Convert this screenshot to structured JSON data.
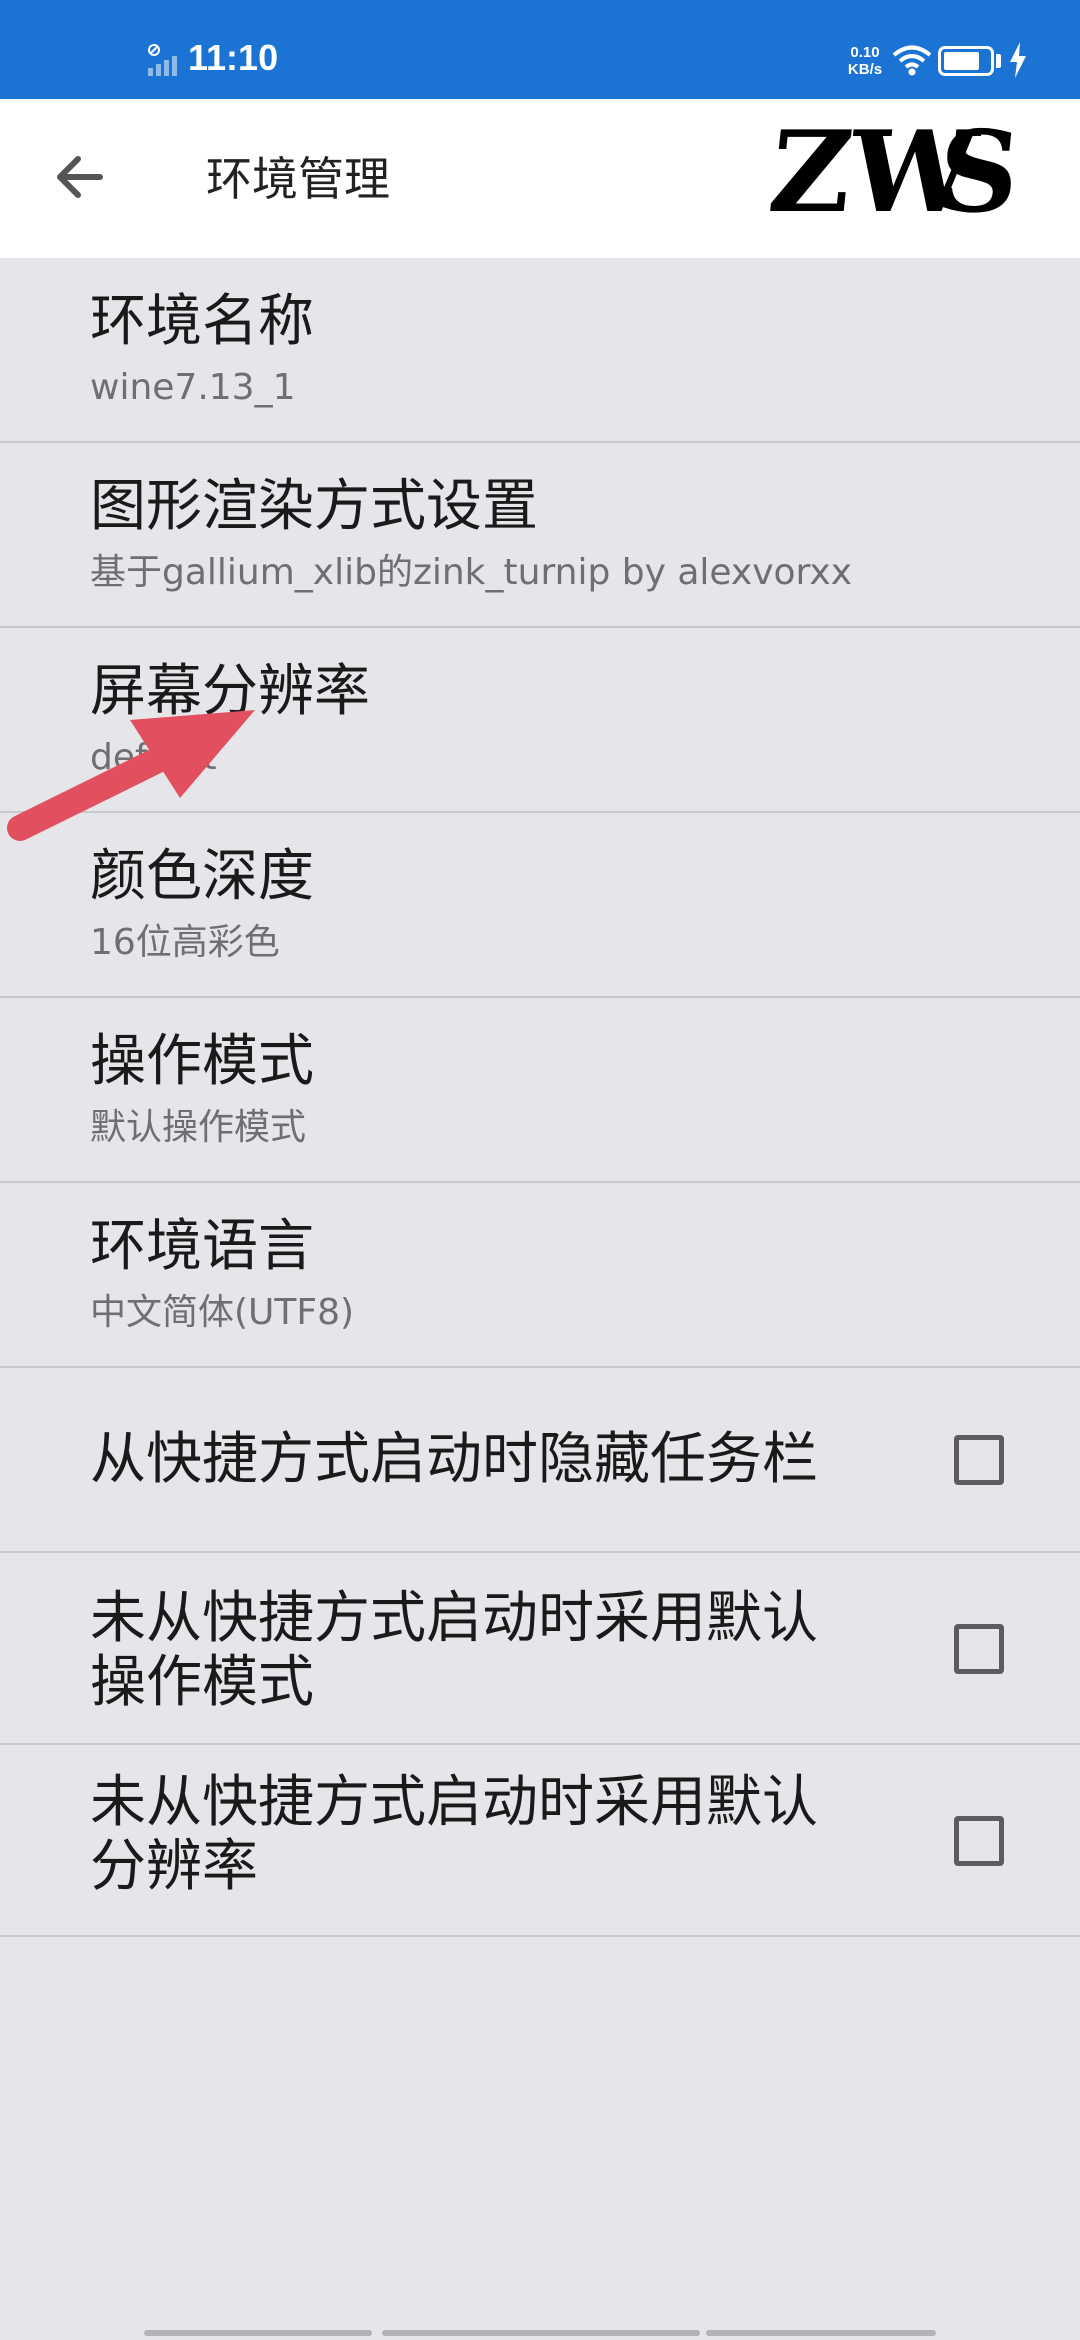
{
  "status_bar": {
    "time": "11:10",
    "net_speed_value": "0.10",
    "net_speed_unit": "KB/s",
    "battery_level": 0.8
  },
  "app_bar": {
    "title": "环境管理",
    "watermark": [
      "Z",
      "W",
      "S"
    ]
  },
  "settings": [
    {
      "title": "环境名称",
      "subtitle": "wine7.13_1"
    },
    {
      "title": "图形渲染方式设置",
      "subtitle": "基于gallium_xlib的zink_turnip by alexvorxx"
    },
    {
      "title": "屏幕分辨率",
      "subtitle": "default"
    },
    {
      "title": "颜色深度",
      "subtitle": "16位高彩色"
    },
    {
      "title": "操作模式",
      "subtitle": "默认操作模式"
    },
    {
      "title": "环境语言",
      "subtitle": "中文简体(UTF8)"
    }
  ],
  "checkbox_settings": [
    {
      "title": "从快捷方式启动时隐藏任务栏",
      "checked": false
    },
    {
      "title": "未从快捷方式启动时采用默认操作模式",
      "line1": "未从快捷方式启动时采用默认",
      "line2": "操作模式",
      "checked": false
    },
    {
      "title": "未从快捷方式启动时采用默认分辨率",
      "line1": "未从快捷方式启动时采用默认",
      "line2": "分辨率",
      "checked": false
    }
  ],
  "colors": {
    "status_bar": "#1b74d4",
    "app_bar": "#ffffff",
    "background": "#e6e5e9",
    "annotation_arrow": "#e2505f"
  }
}
